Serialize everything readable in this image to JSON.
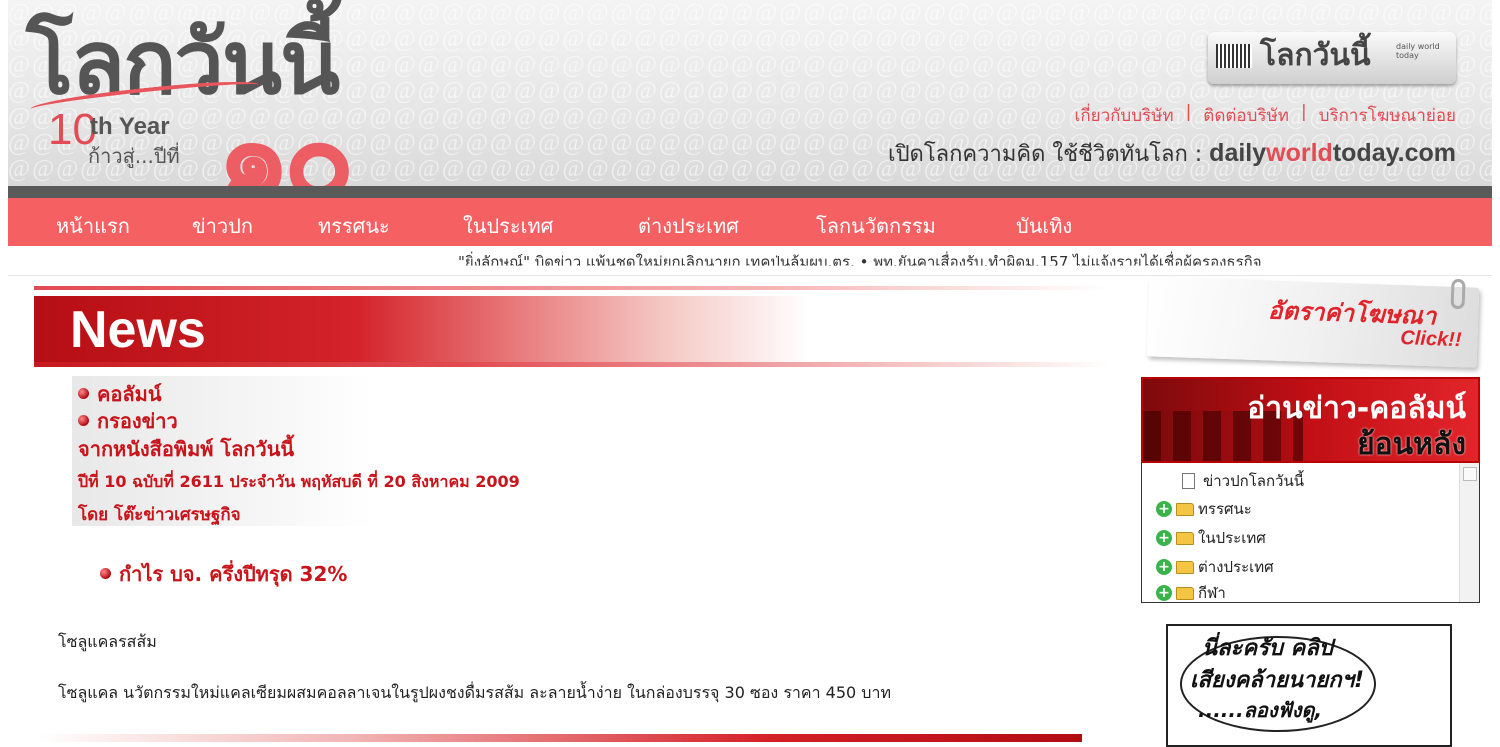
{
  "brand": {
    "logo_text": "โลกวันนี้",
    "anniversary_10th": "10",
    "anniversary_year": "th Year",
    "anniversary_towards": "ก้าวสู่...ปีที่",
    "anniversary_thai_number": "๑๐",
    "paper_name": "โลกวันนี้",
    "paper_tag": "daily world today"
  },
  "top_links": [
    "เกี่ยวกับบริษัท",
    "ติดต่อบริษัท",
    "บริการโฆษณาย่อย"
  ],
  "slogan": {
    "text": "เปิดโลกความคิด ใช้ชีวิตทันโลก :",
    "domain_prefix": "daily",
    "domain_highlight": "world",
    "domain_suffix": "today.com"
  },
  "nav": [
    "หน้าแรก",
    "ข่าวปก",
    "ทรรศนะ",
    "ในประเทศ",
    "ต่างประเทศ",
    "โลกนวัตกรรม",
    "บันเทิง"
  ],
  "ticker": "\"ยิ่งลักษณ์\" บิดข่าว แพ้นชุดใหม่ยกเลิกนายก เทคุปุ่นลุ้มผบ.ตร.  •  พท.ยันคาเสื่องรับ.ทำผิดม.157 ไม่แจ้งรายได้เชื่อผู้ครองธุรกิจ",
  "news_section": {
    "label": "News",
    "column_link": "คอลัมน์",
    "filter_link": "กรองข่าว",
    "source": "จากหนังสือพิมพ์ โลกวันนี้",
    "issue": "ปีที่ 10 ฉบับที่ 2611 ประจำวัน พฤหัสบดี ที่ 20 สิงหาคม 2009",
    "byline": "โดย โต๊ะข่าวเศรษฐกิจ"
  },
  "article": {
    "headline": "กำไร บจ. ครึ่งปีทรุด 32%",
    "subtitle": "โซลูแคลรสส้ม",
    "body": "โซลูแคล นวัตกรรมใหม่แคลเซียมผสมคอลลาเจนในรูปผงชงดื่มรสส้ม ละลายน้ำง่าย ในกล่องบรรจุ 30 ซอง ราคา 450 บาท"
  },
  "sidebar": {
    "ad_title": "อัตราค่าโฆษณา",
    "ad_click": "Click!!",
    "archive_line1": "อ่านข่าว-คอลัมน์",
    "archive_line2": "ย้อนหลัง",
    "tree": [
      {
        "label": "ข่าวปกโลกวันนี้",
        "type": "document"
      },
      {
        "label": "ทรรศนะ",
        "type": "folder"
      },
      {
        "label": "ในประเทศ",
        "type": "folder"
      },
      {
        "label": "ต่างประเทศ",
        "type": "folder"
      },
      {
        "label": "กีฬา",
        "type": "folder"
      }
    ],
    "cartoon_line1": "นี่ละครับ คลิป",
    "cartoon_line2": "เสียงคล้ายนายกฯ!",
    "cartoon_line3": "......ลองฟังดู,"
  },
  "colors": {
    "nav_bg": "#f56063",
    "accent_red": "#c8141b",
    "link_red": "#e34b55"
  }
}
